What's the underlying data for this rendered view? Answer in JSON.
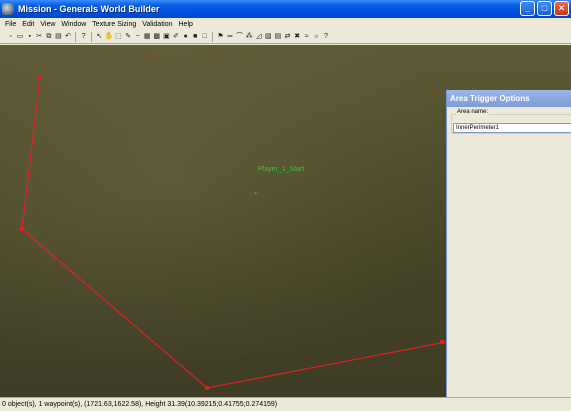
{
  "window": {
    "title": "Mission - Generals World Builder",
    "buttons": {
      "minimize": "_",
      "maximize": "□",
      "close": "✕"
    }
  },
  "menu": {
    "items": [
      "File",
      "Edit",
      "View",
      "Window",
      "Texture Sizing",
      "Validation",
      "Help"
    ]
  },
  "toolbar": {
    "icons": [
      "new-file-icon",
      "open-folder-icon",
      "save-icon",
      "cut-icon",
      "copy-icon",
      "paste-icon",
      "undo-icon",
      "help-icon",
      "pointer-icon",
      "hand-icon",
      "select-area-icon",
      "brush-icon",
      "smooth-icon",
      "tile-icon",
      "grid-icon",
      "checker-icon",
      "eyedropper-icon",
      "circle-tool-icon",
      "filled-square-icon",
      "empty-square-icon",
      "flag-icon",
      "road-icon",
      "bridge-icon",
      "waypoint-icon",
      "polygon-icon",
      "trigger-icon",
      "build-list-icon",
      "links-icon",
      "scorch-icon",
      "water-icon",
      "lighting-icon",
      "info-icon"
    ],
    "glyphs": [
      "▫",
      "▭",
      "▪",
      "✂",
      "⧉",
      "▤",
      "↶",
      "?",
      "↖",
      "✋",
      "⬚",
      "✎",
      "~",
      "▦",
      "▩",
      "▣",
      "✐",
      "●",
      "■",
      "□",
      "⚑",
      "═",
      "⌒",
      "⁂",
      "◿",
      "▨",
      "▤",
      "⇄",
      "✖",
      "≈",
      "☼",
      "?"
    ]
  },
  "viewport": {
    "terrain_label": "Player_1_Start",
    "waypoint_marker": "+"
  },
  "area_trigger": {
    "title": "Area Trigger Options",
    "area_name_label": "Area name:",
    "area_name_value": "InnerPerimeter1"
  },
  "status": {
    "text": "0 object(s), 1 waypoint(s), (1721.63,1622.58), Height 31.39(10.39215;0.41755;0.274159)"
  },
  "colors": {
    "trigger_line": "#e02020",
    "terrain_label": "#3fbf3f",
    "title_bar": "#0054e3"
  }
}
